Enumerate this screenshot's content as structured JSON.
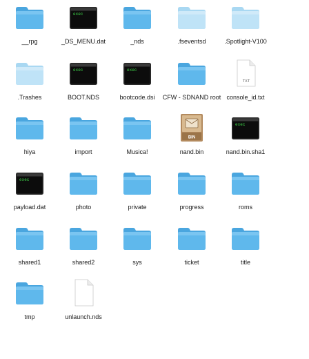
{
  "window": {
    "view": "icon-view"
  },
  "files": [
    {
      "name": "__rpg",
      "kind": "folder"
    },
    {
      "name": "_DS_MENU.dat",
      "kind": "exec"
    },
    {
      "name": "_nds",
      "kind": "folder"
    },
    {
      "name": ".fseventsd",
      "kind": "folder-hidden"
    },
    {
      "name": ".Spotlight-V100",
      "kind": "folder-hidden"
    },
    {
      "name": ".Trashes",
      "kind": "folder-hidden"
    },
    {
      "name": "BOOT.NDS",
      "kind": "exec"
    },
    {
      "name": "bootcode.dsi",
      "kind": "exec"
    },
    {
      "name": "CFW - SDNAND root",
      "kind": "folder"
    },
    {
      "name": "console_id.txt",
      "kind": "txt",
      "badge": "TXT"
    },
    {
      "name": "hiya",
      "kind": "folder"
    },
    {
      "name": "import",
      "kind": "folder"
    },
    {
      "name": "Musica!",
      "kind": "folder"
    },
    {
      "name": "nand.bin",
      "kind": "bin",
      "badge": "BIN"
    },
    {
      "name": "nand.bin.sha1",
      "kind": "exec"
    },
    {
      "name": "payload.dat",
      "kind": "exec"
    },
    {
      "name": "photo",
      "kind": "folder"
    },
    {
      "name": "private",
      "kind": "folder"
    },
    {
      "name": "progress",
      "kind": "folder"
    },
    {
      "name": "roms",
      "kind": "folder"
    },
    {
      "name": "shared1",
      "kind": "folder"
    },
    {
      "name": "shared2",
      "kind": "folder"
    },
    {
      "name": "sys",
      "kind": "folder"
    },
    {
      "name": "ticket",
      "kind": "folder"
    },
    {
      "name": "title",
      "kind": "folder"
    },
    {
      "name": "tmp",
      "kind": "folder"
    },
    {
      "name": "unlaunch.nds",
      "kind": "document"
    }
  ],
  "icons": {
    "exec_text": "exec",
    "folder_color": "#5fb8ec",
    "folder_hidden_color": "#bfe3f7"
  }
}
